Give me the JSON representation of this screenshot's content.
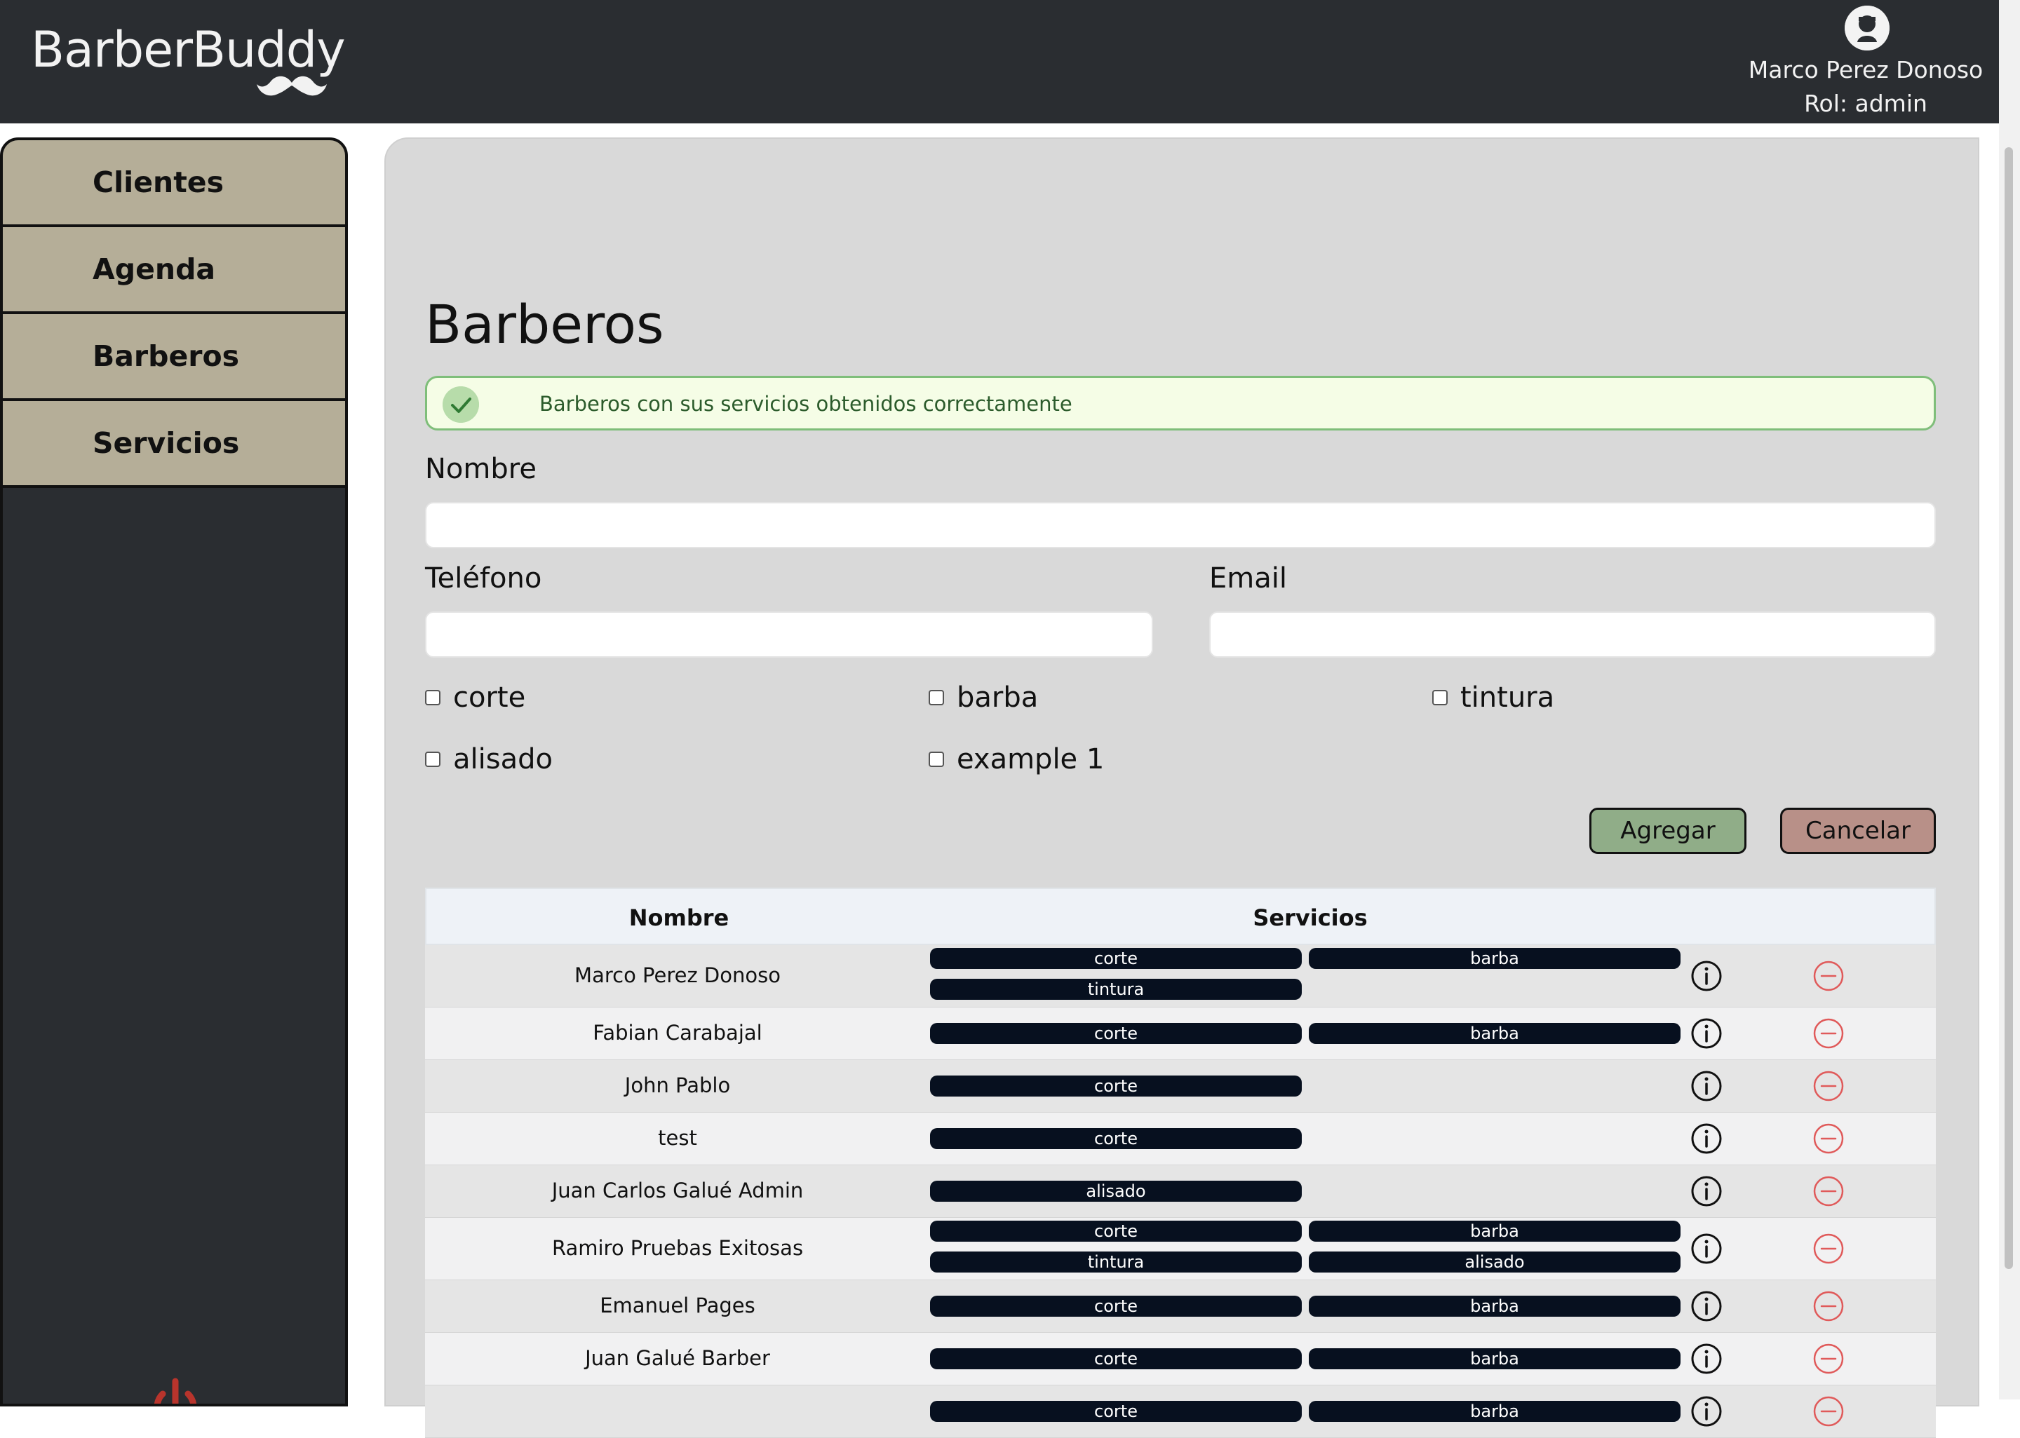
{
  "app": {
    "brand": "BarberBuddy",
    "user_name": "Marco Perez Donoso",
    "user_role": "Rol: admin"
  },
  "sidebar": {
    "items": [
      {
        "label": "Clientes"
      },
      {
        "label": "Agenda"
      },
      {
        "label": "Barberos"
      },
      {
        "label": "Servicios"
      }
    ]
  },
  "page": {
    "title": "Barberos",
    "alert": "Barberos con sus servicios obtenidos correctamente"
  },
  "form": {
    "nombre_label": "Nombre",
    "nombre_value": "",
    "telefono_label": "Teléfono",
    "telefono_value": "",
    "email_label": "Email",
    "email_value": "",
    "services": [
      {
        "label": "corte",
        "checked": false
      },
      {
        "label": "barba",
        "checked": false
      },
      {
        "label": "tintura",
        "checked": false
      },
      {
        "label": "alisado",
        "checked": false
      },
      {
        "label": "example 1",
        "checked": false
      }
    ],
    "add_button": "Agregar",
    "cancel_button": "Cancelar"
  },
  "table": {
    "headers": {
      "nombre": "Nombre",
      "servicios": "Servicios"
    },
    "rows": [
      {
        "name": "Marco Perez Donoso",
        "services": [
          "corte",
          "barba",
          "tintura"
        ]
      },
      {
        "name": "Fabian Carabajal",
        "services": [
          "corte",
          "barba"
        ]
      },
      {
        "name": "John Pablo",
        "services": [
          "corte"
        ]
      },
      {
        "name": "test",
        "services": [
          "corte"
        ]
      },
      {
        "name": "Juan Carlos Galué Admin",
        "services": [
          "alisado"
        ]
      },
      {
        "name": "Ramiro Pruebas Exitosas",
        "services": [
          "corte",
          "barba",
          "tintura",
          "alisado"
        ]
      },
      {
        "name": "Emanuel Pages",
        "services": [
          "corte",
          "barba"
        ]
      },
      {
        "name": "Juan Galué Barber",
        "services": [
          "corte",
          "barba"
        ]
      },
      {
        "name": "",
        "services": [
          "corte",
          "barba"
        ]
      }
    ]
  },
  "colors": {
    "header_bg": "#2a2d31",
    "sidebar_item_bg": "#b5ae98",
    "main_bg": "#d9d9d9",
    "alert_bg": "#f5fde6",
    "alert_border": "#7fbe7a",
    "tag_bg": "#07101f",
    "add_btn": "#90ad88",
    "cancel_btn": "#b89088",
    "delete_icon": "#e05a5a"
  },
  "icons": {
    "brand": "mustache-icon",
    "avatar": "barber-avatar-icon",
    "alert": "check-circle-icon",
    "row_info": "info-icon",
    "row_delete": "minus-circle-icon",
    "logout": "power-icon"
  }
}
